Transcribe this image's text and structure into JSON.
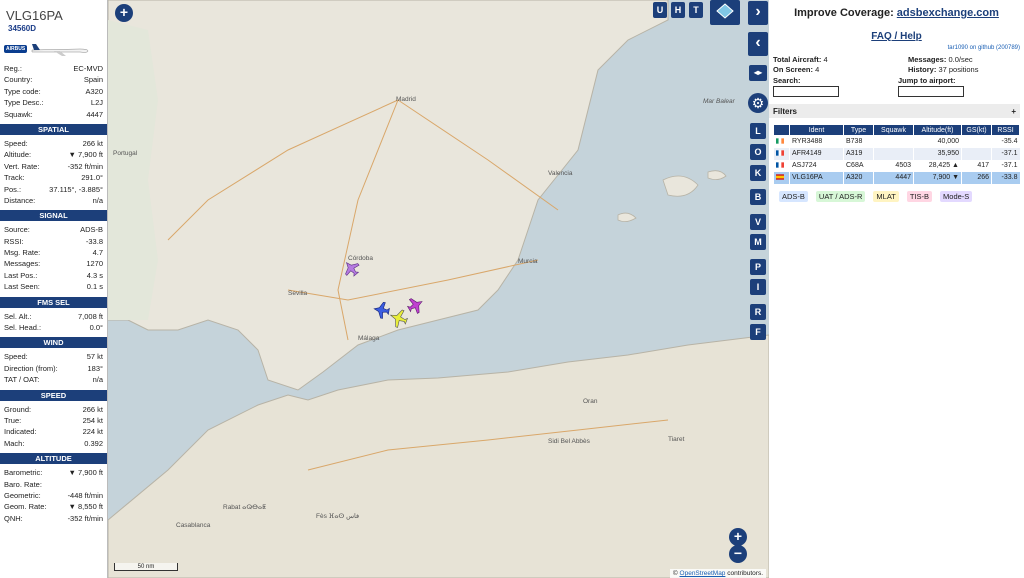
{
  "aircraft": {
    "callsign": "VLG16PA",
    "hex": "34560D",
    "airline_logo": "AIRBUS",
    "reg_label": "Reg.:",
    "reg": "EC-MVD",
    "country_label": "Country:",
    "country": "Spain",
    "typecode_label": "Type code:",
    "typecode": "A320",
    "typedesc_label": "Type Desc.:",
    "typedesc": "L2J",
    "squawk_label": "Squawk:",
    "squawk": "4447"
  },
  "spatial": {
    "title": "SPATIAL",
    "speed_label": "Speed:",
    "speed": "266 kt",
    "altitude_label": "Altitude:",
    "altitude": "▼ 7,900 ft",
    "vrate_label": "Vert. Rate:",
    "vrate": "-352 ft/min",
    "track_label": "Track:",
    "track": "291.0°",
    "pos_label": "Pos.:",
    "pos": "37.115°, -3.885°",
    "distance_label": "Distance:",
    "distance": "n/a"
  },
  "signal": {
    "title": "SIGNAL",
    "source_label": "Source:",
    "source": "ADS-B",
    "rssi_label": "RSSI:",
    "rssi": "-33.8",
    "msgrate_label": "Msg. Rate:",
    "msgrate": "4.7",
    "messages_label": "Messages:",
    "messages": "1270",
    "lastpos_label": "Last Pos.:",
    "lastpos": "4.3 s",
    "lastseen_label": "Last Seen:",
    "lastseen": "0.1 s"
  },
  "fmssel": {
    "title": "FMS SEL",
    "selalt_label": "Sel. Alt.:",
    "selalt": "7,008 ft",
    "selhead_label": "Sel. Head.:",
    "selhead": "0.0°"
  },
  "wind": {
    "title": "WIND",
    "speed_label": "Speed:",
    "speed": "57 kt",
    "dir_label": "Direction (from):",
    "dir": "183°",
    "tat_label": "TAT / OAT:",
    "tat": "n/a"
  },
  "speed": {
    "title": "SPEED",
    "ground_label": "Ground:",
    "ground": "266 kt",
    "true_label": "True:",
    "true": "254 kt",
    "indicated_label": "Indicated:",
    "indicated": "224 kt",
    "mach_label": "Mach:",
    "mach": "0.392"
  },
  "altitude": {
    "title": "ALTITUDE",
    "baro_label": "Barometric:",
    "baro": "▼ 7,900 ft",
    "barorate_label": "Baro. Rate:",
    "barorate": "",
    "geom_label": "Geometric:",
    "geom": "-448 ft/min",
    "geomrate_label": "Geom. Rate:",
    "geomrate": "▼ 8,550 ft",
    "qnh_label": "QNH:",
    "qnh": "-352 ft/min"
  },
  "map": {
    "buttons": {
      "u": "U",
      "h": "H",
      "t": "T"
    },
    "side_letters": [
      "L",
      "O",
      "K",
      "B",
      "V",
      "M",
      "P",
      "I",
      "R",
      "F"
    ],
    "scale": "50 nm",
    "attribution_prefix": "© ",
    "attribution_link": "OpenStreetMap",
    "attribution_suffix": " contributors.",
    "places": {
      "madrid": "Madrid",
      "portugal": "Portugal",
      "sevilla": "Sevilla",
      "malaga": "Málaga",
      "murcia": "Murcia",
      "valencia": "Valencia",
      "cordoba": "Córdoba",
      "sidi": "Sidi Bel Abbès",
      "fes": "Fès ⴼⴰⵙ فاس",
      "rabat": "Rabat ⴰⵕⴱⴰⵟ",
      "casablanca": "Casablanca",
      "tiaret": "Tiaret",
      "mar": "Mar Balear",
      "alger": "Oran"
    }
  },
  "right": {
    "improve": "Improve Coverage: ",
    "improve_link": "adsbexchange.com",
    "faq": "FAQ / Help",
    "version": "tar1090 on github (200789)",
    "total_label": "Total Aircraft:",
    "total": "4",
    "onscreen_label": "On Screen:",
    "onscreen": "4",
    "messages_label": "Messages:",
    "messages": "0.0/sec",
    "history_label": "History:",
    "history": "37 positions",
    "search_label": "Search:",
    "jump_label": "Jump to airport:",
    "filters": "Filters",
    "filters_plus": "+",
    "columns": [
      "Ident",
      "Type",
      "Squawk",
      "Altitude(ft)",
      "GS(kt)",
      "RSSI"
    ],
    "rows": [
      {
        "flag": "ie",
        "ident": "RYR3488",
        "type": "B738",
        "squawk": "",
        "alt": "40,000",
        "gs": "",
        "rssi": "-35.4"
      },
      {
        "flag": "fr",
        "ident": "AFR4149",
        "type": "A319",
        "squawk": "",
        "alt": "35,950",
        "gs": "",
        "rssi": "-37.1"
      },
      {
        "flag": "fr",
        "ident": "ASJ724",
        "type": "C68A",
        "squawk": "4503",
        "alt": "28,425 ▲",
        "gs": "417",
        "rssi": "-37.1"
      },
      {
        "flag": "es",
        "ident": "VLG16PA",
        "type": "A320",
        "squawk": "4447",
        "alt": "7,900 ▼",
        "gs": "266",
        "rssi": "-33.8"
      }
    ],
    "legend": [
      "ADS-B",
      "UAT / ADS-R",
      "MLAT",
      "TIS-B",
      "Mode-S"
    ],
    "legend_colors": [
      "#d6e6ff",
      "#d7f7d7",
      "#fff4c2",
      "#ffd6e3",
      "#e3d9ff"
    ]
  }
}
